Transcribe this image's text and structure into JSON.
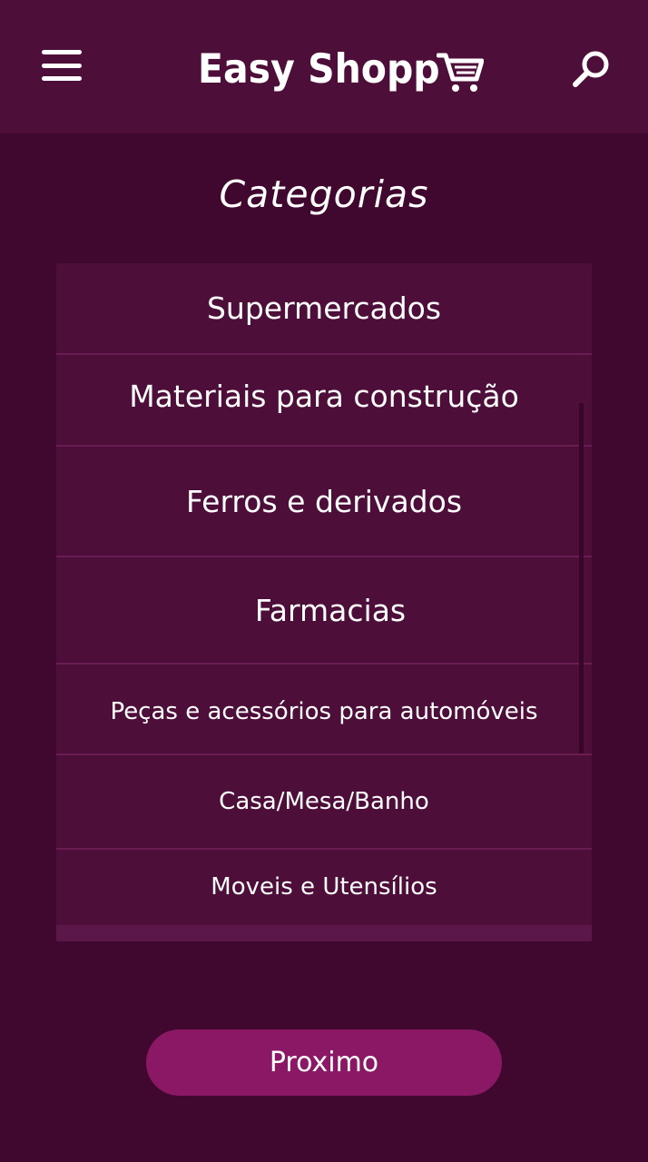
{
  "header": {
    "logo_text": "Easy Shopp",
    "menu_icon": "hamburger-menu-icon",
    "logo_icon": "shopping-cart-icon",
    "search_icon": "search-icon",
    "background": "#4d0e39"
  },
  "page": {
    "title": "Categorias",
    "background": "#41082f"
  },
  "categories": [
    {
      "label": "Supermercados"
    },
    {
      "label": "Materiais para construção"
    },
    {
      "label": "Ferros e derivados"
    },
    {
      "label": "Farmacias"
    },
    {
      "label": "Peças e acessórios para automóveis"
    },
    {
      "label": "Casa/Mesa/Banho"
    },
    {
      "label": "Moveis e Utensílios"
    }
  ],
  "next_button": {
    "label": "Proximo",
    "color": "#8a1865"
  }
}
